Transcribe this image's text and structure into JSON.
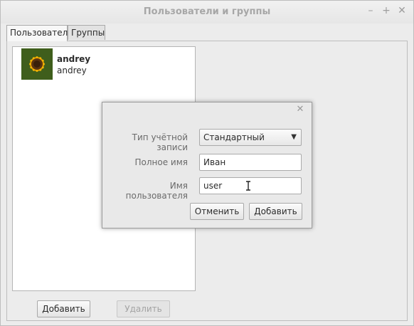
{
  "window": {
    "title": "Пользователи и группы"
  },
  "tabs": [
    {
      "label": "Пользователи"
    },
    {
      "label": "Группы"
    }
  ],
  "users": [
    {
      "display_name": "andrey",
      "username": "andrey"
    }
  ],
  "main_buttons": {
    "add": "Добавить",
    "remove": "Удалить"
  },
  "dialog": {
    "account_type_label": "Тип учётной записи",
    "account_type_value": "Стандартный",
    "full_name_label": "Полное имя",
    "full_name_value": "Иван",
    "username_label": "Имя пользователя",
    "username_value": "user",
    "cancel_label": "Отменить",
    "add_label": "Добавить"
  },
  "colors": {
    "window_bg": "#ececec",
    "title_text": "#a7a7a7",
    "dialog_bg": "#e9e9e9"
  }
}
